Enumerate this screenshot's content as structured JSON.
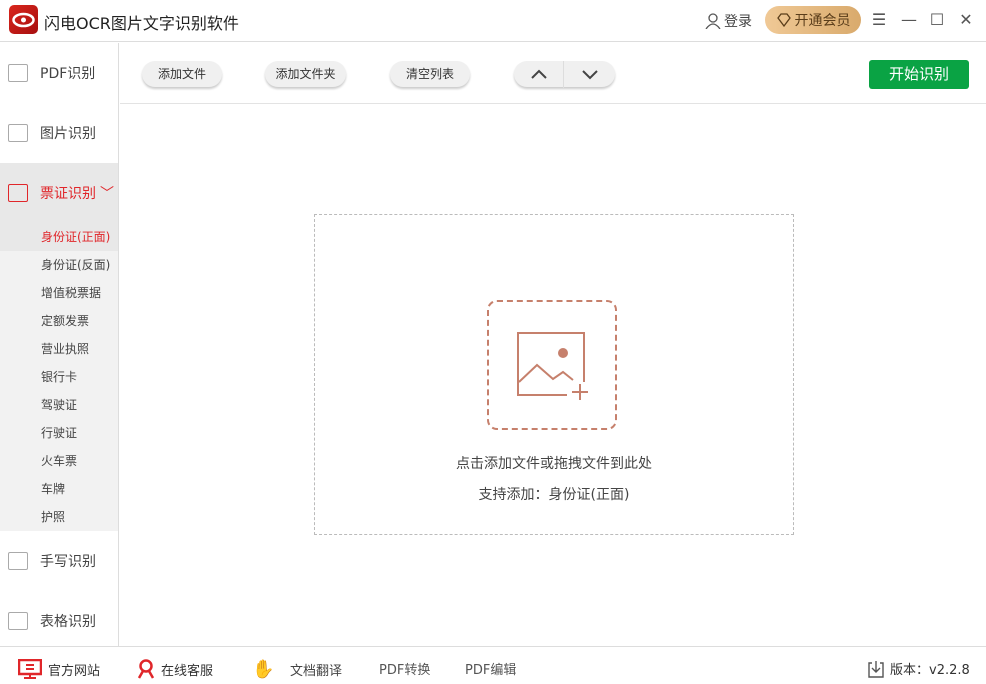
{
  "app": {
    "title": "闪电OCR图片文字识别软件",
    "login": "登录",
    "vip": "开通会员"
  },
  "sidebar": {
    "items": [
      {
        "label": "PDF识别"
      },
      {
        "label": "图片识别"
      },
      {
        "label": "票证识别"
      },
      {
        "label": "手写识别"
      },
      {
        "label": "表格识别"
      }
    ],
    "sub_items": [
      "身份证(正面)",
      "身份证(反面)",
      "增值税票据",
      "定额发票",
      "营业执照",
      "银行卡",
      "驾驶证",
      "行驶证",
      "火车票",
      "车牌",
      "护照"
    ]
  },
  "toolbar": {
    "add_file": "添加文件",
    "add_folder": "添加文件夹",
    "clear": "清空列表",
    "start": "开始识别"
  },
  "drop": {
    "hint": "点击添加文件或拖拽文件到此处",
    "support": "支持添加：身份证(正面)"
  },
  "footer": {
    "site": "官方网站",
    "service": "在线客服",
    "translate": "文档翻译",
    "pdf_convert": "PDF转换",
    "pdf_edit": "PDF编辑",
    "version": "版本：v2.2.8"
  }
}
